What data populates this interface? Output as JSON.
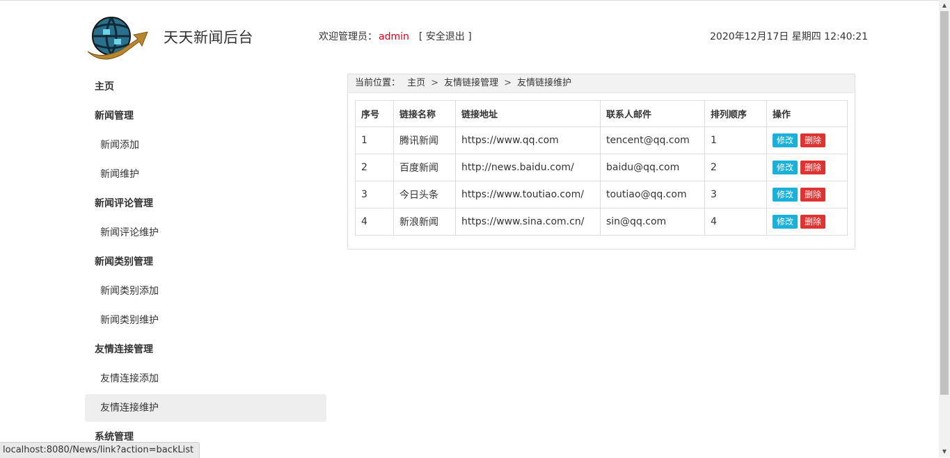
{
  "header": {
    "app_title": "天天新闻后台",
    "welcome_prefix": "欢迎管理员：",
    "username": "admin",
    "logout_label": "[ 安全退出 ]",
    "datetime": "2020年12月17日 星期四 12:40:21"
  },
  "sidebar": {
    "items": [
      {
        "label": "主页",
        "type": "group"
      },
      {
        "label": "新闻管理",
        "type": "group"
      },
      {
        "label": "新闻添加",
        "type": "sub"
      },
      {
        "label": "新闻维护",
        "type": "sub"
      },
      {
        "label": "新闻评论管理",
        "type": "group"
      },
      {
        "label": "新闻评论维护",
        "type": "sub"
      },
      {
        "label": "新闻类别管理",
        "type": "group"
      },
      {
        "label": "新闻类别添加",
        "type": "sub"
      },
      {
        "label": "新闻类别维护",
        "type": "sub"
      },
      {
        "label": "友情连接管理",
        "type": "group"
      },
      {
        "label": "友情连接添加",
        "type": "sub"
      },
      {
        "label": "友情连接维护",
        "type": "sub",
        "active": true
      },
      {
        "label": "系统管理",
        "type": "group"
      }
    ]
  },
  "breadcrumb": {
    "prefix": "当前位置：",
    "items": [
      "主页",
      "友情链接管理",
      "友情链接维护"
    ],
    "separator": ">"
  },
  "table": {
    "headers": [
      "序号",
      "链接名称",
      "链接地址",
      "联系人邮件",
      "排列顺序",
      "操作"
    ],
    "rows": [
      {
        "id": "1",
        "name": "腾讯新闻",
        "url": "https://www.qq.com",
        "email": "tencent@qq.com",
        "order": "1"
      },
      {
        "id": "2",
        "name": "百度新闻",
        "url": "http://news.baidu.com/",
        "email": "baidu@qq.com",
        "order": "2"
      },
      {
        "id": "3",
        "name": "今日头条",
        "url": "https://www.toutiao.com/",
        "email": "toutiao@qq.com",
        "order": "3"
      },
      {
        "id": "4",
        "name": "新浪新闻",
        "url": "https://www.sina.com.cn/",
        "email": "sin@qq.com",
        "order": "4"
      }
    ],
    "edit_label": "修改",
    "delete_label": "删除"
  },
  "statusbar": {
    "url": "localhost:8080/News/link?action=backList"
  },
  "colors": {
    "username": "#d9001b",
    "edit_button": "#1ab0d8",
    "delete_button": "#dd3333",
    "active_nav_bg": "#eeeeee"
  }
}
